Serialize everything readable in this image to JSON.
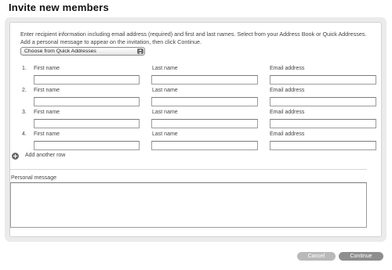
{
  "title": "Invite new members",
  "instructions": "Enter recipient information including email address (required) and first and last names. Select from your Address Book or Quick Addresses. Add a personal message to appear on the invitation, then click Continue.",
  "quick_select": {
    "value": "Choose from Quick Addresses"
  },
  "field_labels": {
    "first": "First name",
    "last": "Last name",
    "email": "Email address"
  },
  "rows": [
    {
      "num": "1.",
      "first": "",
      "last": "",
      "email": ""
    },
    {
      "num": "2.",
      "first": "",
      "last": "",
      "email": ""
    },
    {
      "num": "3.",
      "first": "",
      "last": "",
      "email": ""
    },
    {
      "num": "4.",
      "first": "",
      "last": "",
      "email": ""
    }
  ],
  "add_row_label": "Add another row",
  "personal_message": {
    "label": "Personal message",
    "value": ""
  },
  "buttons": {
    "cancel": "Cancel",
    "continue": "Continue"
  },
  "icons": {
    "add_row": "plus-circle-icon",
    "select": "updown-arrows-icon"
  }
}
